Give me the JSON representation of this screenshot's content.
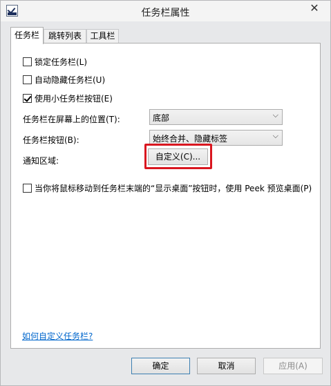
{
  "window": {
    "title": "任务栏属性",
    "close_symbol": "✕"
  },
  "tabs": [
    {
      "label": "任务栏",
      "active": true
    },
    {
      "label": "跳转列表",
      "active": false
    },
    {
      "label": "工具栏",
      "active": false
    }
  ],
  "taskbar": {
    "lock_label": "锁定任务栏(L)",
    "lock_checked": false,
    "autohide_label": "自动隐藏任务栏(U)",
    "autohide_checked": false,
    "small_buttons_label": "使用小任务栏按钮(E)",
    "small_buttons_checked": true,
    "position_label": "任务栏在屏幕上的位置(T):",
    "position_value": "底部",
    "buttons_label": "任务栏按钮(B):",
    "buttons_value": "始终合并、隐藏标签",
    "notify_label": "通知区域:",
    "customize_button": "自定义(C)...",
    "peek_label": "当你将鼠标移动到任务栏末端的“显示桌面”按钮时，使用 Peek 预览桌面(P)",
    "peek_checked": false,
    "help_link": "如何自定义任务栏?"
  },
  "footer": {
    "ok_label": "确定",
    "cancel_label": "取消",
    "apply_label": "应用(A)"
  },
  "colors": {
    "highlight": "#d9161f",
    "link": "#0066cc",
    "ok_border": "#3c7fb1"
  }
}
